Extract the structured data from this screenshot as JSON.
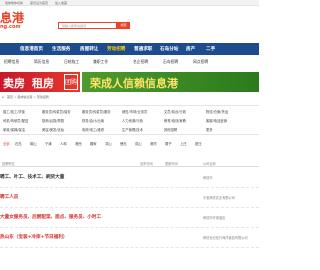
{
  "topbar": {
    "items": [
      "简体繁体切换",
      "首页设为首页",
      "加入收藏"
    ]
  },
  "logo": {
    "main": "息港",
    "sub": "ng.com"
  },
  "search": {
    "placeholder": "请输入搜索关键词",
    "button": "搜索"
  },
  "nav": {
    "items": [
      {
        "label": "信息港首页",
        "hot": false
      },
      {
        "label": "生活服务",
        "hot": false
      },
      {
        "label": "房屋转让",
        "hot": false
      },
      {
        "label": "劳动招聘",
        "hot": true
      },
      {
        "label": "普通求职",
        "hot": false
      },
      {
        "label": "石岛分站",
        "hot": false
      },
      {
        "label": "房产",
        "hot": false
      },
      {
        "label": "二手",
        "hot": false
      }
    ]
  },
  "subnav": {
    "items": [
      "招聘信息",
      "简历信息",
      "日结临工",
      "兼职工作",
      "名企招聘",
      "石岛招聘",
      "网点招聘"
    ]
  },
  "banner1": {
    "text1": "卖房",
    "text2": "租房",
    "tag": "团购"
  },
  "banner2": {
    "text": "荣成人信赖信息港"
  },
  "breadcrumb": {
    "text": "首页 > 荣成信息港 > 劳动招聘"
  },
  "categories": {
    "rows": [
      [
        "普工/技工/学徒",
        "服务员/传菜员/保安",
        "服务员/传菜员/服务",
        "销售/市场/业务员",
        "文员/前台/行政",
        "物流/仓管/货运"
      ],
      [
        "司机/驾驶员/配送",
        "厨师/后厨/帮厨",
        "财务/会计/出纳",
        "人力资源/行政",
        "教育/培训/家教",
        "客服/电话营销"
      ],
      [
        "家政/保姆/保洁",
        "美容/美发/化妆",
        "电焊/电工/维修",
        "生产管理/技术",
        "其他招聘",
        "更多"
      ]
    ]
  },
  "tags": {
    "items": [
      "全部",
      "石岛",
      "崂山",
      "宁津",
      "人和",
      "港西",
      "滕家",
      "寻山",
      "俚岛",
      "成山",
      "港湾",
      "荫子",
      "上庄",
      "夏庄"
    ]
  },
  "list": {
    "headers": [
      "招聘职位",
      "发布时间",
      "更新时间",
      "公司名称"
    ],
    "rows": [
      {
        "title": "聘工、叶工、技术工、刷货大量",
        "red": false,
        "company": "荣成市"
      },
      {
        "title": "聘工人员",
        "red": true,
        "company": "中宝荣成实业有限公司"
      },
      {
        "title": "大量女服务员、后厨配菜、面点、服务员、小时工",
        "red": true,
        "company": "荣成市环球酒店"
      },
      {
        "title": "热山东（宝装+冷库+节日福利）",
        "red": true,
        "company": "荣成世纪宏兴海洋食品有限公司"
      }
    ]
  },
  "colors": {
    "accent": "#e8442a",
    "nav": "#1d4c8e"
  }
}
